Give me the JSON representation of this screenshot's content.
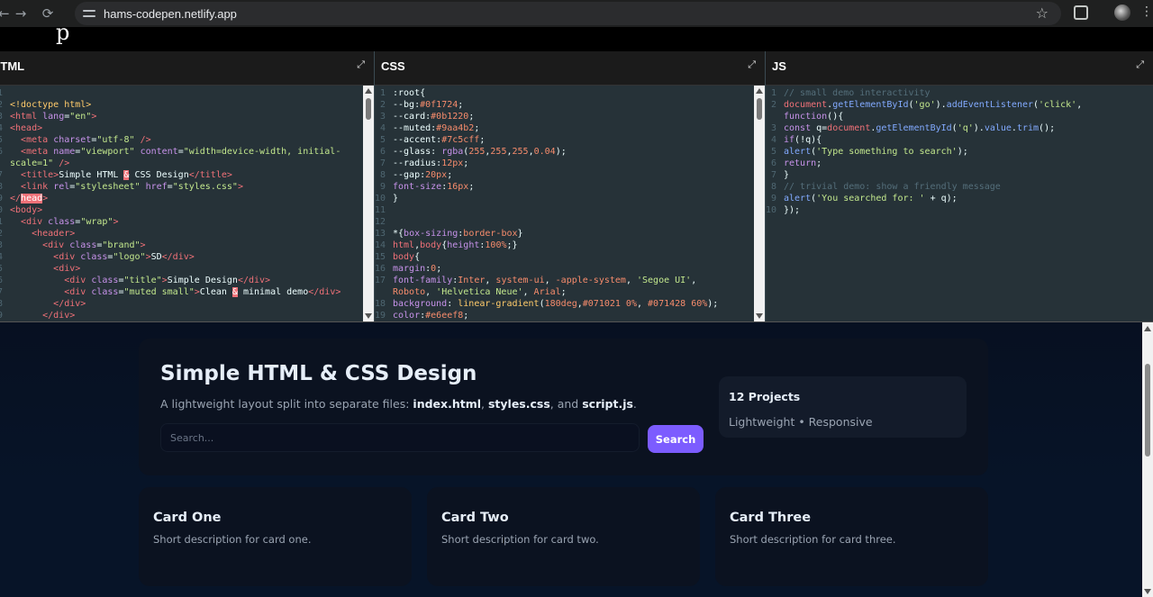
{
  "browser": {
    "url": "hams-codepen.netlify.app",
    "back_icon": "←",
    "forward_icon": "→",
    "reload_icon": "⟳",
    "star_icon": "☆",
    "menu_icon": "⋮"
  },
  "topbar_glyph": "p",
  "panes": {
    "html": {
      "title": "HTML",
      "expand_icon": "⤢"
    },
    "css": {
      "title": "CSS",
      "expand_icon": "⤢"
    },
    "js": {
      "title": "JS",
      "expand_icon": "⤢"
    }
  },
  "html_code": [
    {
      "n": "1",
      "html": ""
    },
    {
      "n": "2",
      "html": "<span class=\"v\">&lt;!doctype html&gt;</span>"
    },
    {
      "n": "3",
      "html": "<span class=\"k\">&lt;html</span> <span class=\"a\">lang</span>=<span class=\"s\">\"en\"</span><span class=\"k\">&gt;</span>"
    },
    {
      "n": "4",
      "html": "<span class=\"k\">&lt;head&gt;</span>"
    },
    {
      "n": "5",
      "html": "  <span class=\"k\">&lt;meta</span> <span class=\"a\">charset</span>=<span class=\"s\">\"utf-8\"</span> <span class=\"k\">/&gt;</span>"
    },
    {
      "n": "6",
      "html": "  <span class=\"k\">&lt;meta</span> <span class=\"a\">name</span>=<span class=\"s\">\"viewport\"</span> <span class=\"a\">content</span>=<span class=\"s\">\"width=device-width, initial-</span>"
    },
    {
      "n": "",
      "html": "<span class=\"s\">scale=1\"</span> <span class=\"k\">/&gt;</span>"
    },
    {
      "n": "7",
      "html": "  <span class=\"k\">&lt;title&gt;</span>Simple HTML <span class=\"hl\">&amp;</span> CSS Design<span class=\"k\">&lt;/title&gt;</span>"
    },
    {
      "n": "8",
      "html": "  <span class=\"k\">&lt;link</span> <span class=\"a\">rel</span>=<span class=\"s\">\"stylesheet\"</span> <span class=\"a\">href</span>=<span class=\"s\">\"styles.css\"</span><span class=\"k\">&gt;</span>"
    },
    {
      "n": "9",
      "html": "<span class=\"k\">&lt;/</span><span class=\"hl\">head</span><span class=\"k\">&gt;</span>"
    },
    {
      "n": "10",
      "html": "<span class=\"k\">&lt;body&gt;</span>"
    },
    {
      "n": "11",
      "html": "  <span class=\"k\">&lt;div</span> <span class=\"a\">class</span>=<span class=\"s\">\"wrap\"</span><span class=\"k\">&gt;</span>"
    },
    {
      "n": "12",
      "html": "    <span class=\"k\">&lt;header&gt;</span>"
    },
    {
      "n": "13",
      "html": "      <span class=\"k\">&lt;div</span> <span class=\"a\">class</span>=<span class=\"s\">\"brand\"</span><span class=\"k\">&gt;</span>"
    },
    {
      "n": "14",
      "html": "        <span class=\"k\">&lt;div</span> <span class=\"a\">class</span>=<span class=\"s\">\"logo\"</span><span class=\"k\">&gt;</span>SD<span class=\"k\">&lt;/div&gt;</span>"
    },
    {
      "n": "15",
      "html": "        <span class=\"k\">&lt;div&gt;</span>"
    },
    {
      "n": "16",
      "html": "          <span class=\"k\">&lt;div</span> <span class=\"a\">class</span>=<span class=\"s\">\"title\"</span><span class=\"k\">&gt;</span>Simple Design<span class=\"k\">&lt;/div&gt;</span>"
    },
    {
      "n": "17",
      "html": "          <span class=\"k\">&lt;div</span> <span class=\"a\">class</span>=<span class=\"s\">\"muted small\"</span><span class=\"k\">&gt;</span>Clean <span class=\"hl\">&amp;</span> minimal demo<span class=\"k\">&lt;/div&gt;</span>"
    },
    {
      "n": "18",
      "html": "        <span class=\"k\">&lt;/div&gt;</span>"
    },
    {
      "n": "19",
      "html": "      <span class=\"k\">&lt;/div&gt;</span>"
    }
  ],
  "css_code": [
    {
      "n": "1",
      "html": ":root{"
    },
    {
      "n": "2",
      "html": "--bg:<span class=\"n\">#0f1724</span>;"
    },
    {
      "n": "3",
      "html": "--card:<span class=\"n\">#0b1220</span>;"
    },
    {
      "n": "4",
      "html": "--muted:<span class=\"n\">#9aa4b2</span>;"
    },
    {
      "n": "5",
      "html": "--accent:<span class=\"n\">#7c5cff</span>;"
    },
    {
      "n": "6",
      "html": "--glass: <span class=\"a\">rgba</span>(<span class=\"n\">255</span>,<span class=\"n\">255</span>,<span class=\"n\">255</span>,<span class=\"n\">0.04</span>);"
    },
    {
      "n": "7",
      "html": "--radius:<span class=\"n\">12px</span>;"
    },
    {
      "n": "8",
      "html": "--gap:<span class=\"n\">20px</span>;"
    },
    {
      "n": "9",
      "html": "<span class=\"a\">font-size</span>:<span class=\"n\">16px</span>;"
    },
    {
      "n": "10",
      "html": "}"
    },
    {
      "n": "11",
      "html": ""
    },
    {
      "n": "12",
      "html": ""
    },
    {
      "n": "13",
      "html": "*{<span class=\"a\">box-sizing</span>:<span class=\"n\">border-box</span>}"
    },
    {
      "n": "14",
      "html": "<span class=\"k\">html</span>,<span class=\"k\">body</span>{<span class=\"a\">height</span>:<span class=\"n\">100%</span>;}"
    },
    {
      "n": "15",
      "html": "<span class=\"k\">body</span>{"
    },
    {
      "n": "16",
      "html": "<span class=\"a\">margin</span>:<span class=\"n\">0</span>;"
    },
    {
      "n": "17",
      "html": "<span class=\"a\">font-family</span>:<span class=\"n\">Inter</span>, <span class=\"n\">system-ui</span>, <span class=\"n\">-apple-system</span>, <span class=\"s\">'Segoe UI'</span>,"
    },
    {
      "n": "",
      "html": "<span class=\"n\">Roboto</span>, <span class=\"s\">'Helvetica Neue'</span>, <span class=\"n\">Arial</span>;"
    },
    {
      "n": "18",
      "html": "<span class=\"a\">background</span>: <span class=\"v\">linear-gradient</span>(<span class=\"n\">180deg</span>,<span class=\"n\">#071021 0%</span>, <span class=\"n\">#071428 60%</span>);"
    },
    {
      "n": "19",
      "html": "<span class=\"a\">color</span>:<span class=\"n\">#e6eef8</span>;"
    }
  ],
  "js_code": [
    {
      "n": "1",
      "html": "<span class=\"c\">// small demo interactivity</span>"
    },
    {
      "n": "2",
      "html": "<span class=\"k\">document</span>.<span class=\"f\">getElementById</span>(<span class=\"s\">'go'</span>).<span class=\"f\">addEventListener</span>(<span class=\"s\">'click'</span>,"
    },
    {
      "n": "",
      "html": "<span class=\"a\">function</span>(){"
    },
    {
      "n": "3",
      "html": "<span class=\"a\">const</span> q=<span class=\"k\">document</span>.<span class=\"f\">getElementById</span>(<span class=\"s\">'q'</span>).<span class=\"f\">value</span>.<span class=\"f\">trim</span>();"
    },
    {
      "n": "4",
      "html": "<span class=\"a\">if</span>(!q){"
    },
    {
      "n": "5",
      "html": "<span class=\"f\">alert</span>(<span class=\"s\">'Type something to search'</span>);"
    },
    {
      "n": "6",
      "html": "<span class=\"a\">return</span>;"
    },
    {
      "n": "7",
      "html": "}"
    },
    {
      "n": "8",
      "html": "<span class=\"c\">// trivial demo: show a friendly message</span>"
    },
    {
      "n": "9",
      "html": "<span class=\"f\">alert</span>(<span class=\"s\">'You searched for: '</span> + q);"
    },
    {
      "n": "10",
      "html": "});"
    }
  ],
  "preview": {
    "title": "Simple HTML & CSS Design",
    "subtitle_pre": "A lightweight layout split into separate files: ",
    "file1": "index.html",
    "sep1": ", ",
    "file2": "styles.css",
    "sep2": ", and ",
    "file3": "script.js",
    "subtitle_post": ".",
    "search_placeholder": "Search...",
    "search_button": "Search",
    "stat_title": "12 Projects",
    "stat_sub": "Lightweight • Responsive",
    "cards": [
      {
        "title": "Card One",
        "desc": "Short description for card one."
      },
      {
        "title": "Card Two",
        "desc": "Short description for card two."
      },
      {
        "title": "Card Three",
        "desc": "Short description for card three."
      }
    ]
  },
  "colors": {
    "bg": "#0f1724",
    "card": "#0b1220",
    "muted": "#9aa4b2",
    "accent": "#7c5cff",
    "text": "#e6eef8",
    "editor_bg": "#263238"
  }
}
